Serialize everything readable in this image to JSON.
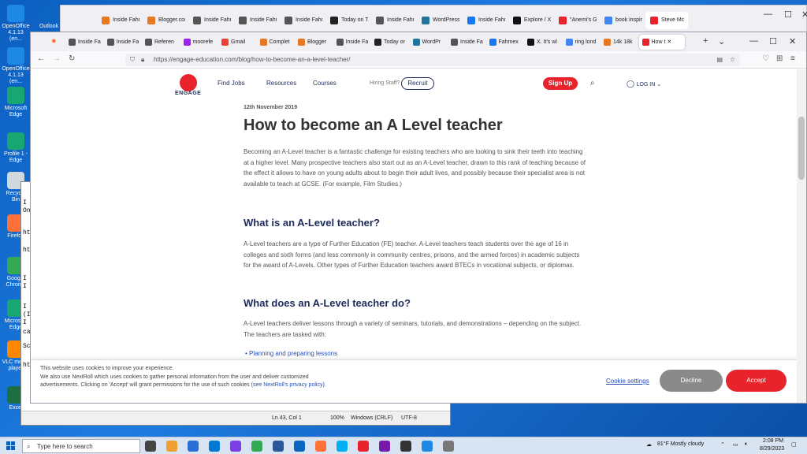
{
  "desktop": {
    "icons": [
      {
        "label": "OpenOffice 4.1.13 (en...",
        "color": "#1e88e5"
      },
      {
        "label": "OpenOffice 4.1.13 (en...",
        "color": "#1e88e5"
      },
      {
        "label": "Microsoft Edge",
        "color": "#18a673"
      },
      {
        "label": "Profile 1 - Edge",
        "color": "#18a673"
      },
      {
        "label": "Recycle Bin",
        "color": "#cfd8dc"
      },
      {
        "label": "Firefox",
        "color": "#ff7139"
      },
      {
        "label": "Google Chrome",
        "color": "#34a853"
      },
      {
        "label": "Microsoft Edge",
        "color": "#18a673"
      },
      {
        "label": "VLC media player",
        "color": "#ff8800"
      },
      {
        "label": "Excel",
        "color": "#1d6f42"
      }
    ],
    "second_icon": {
      "label": "Outlook",
      "color": "#0a64c0"
    }
  },
  "back_window": {
    "tabs": [
      {
        "label": "Inside Fahm",
        "color": "#e87722"
      },
      {
        "label": "Blogger.com",
        "color": "#e87722"
      },
      {
        "label": "Inside Fahm",
        "color": "#555"
      },
      {
        "label": "Inside Fahm",
        "color": "#555"
      },
      {
        "label": "Inside Fahmex",
        "color": "#555"
      },
      {
        "label": "Today on Tu",
        "color": "#222"
      },
      {
        "label": "Inside Fahm",
        "color": "#555"
      },
      {
        "label": "WordPress.c",
        "color": "#21759b"
      },
      {
        "label": "Inside Fahm",
        "color": "#1877f2"
      },
      {
        "label": "Explore / X",
        "color": "#111"
      },
      {
        "label": "\"Anemi's G",
        "color": "#e8232b"
      },
      {
        "label": "book inspir",
        "color": "#4285f4"
      },
      {
        "label": "Steve Mc",
        "color": "#e8232b"
      }
    ]
  },
  "notepad": {
    "lines": [
      "I",
      "On",
      "ht",
      "ht",
      "I",
      "I",
      "I",
      "(I",
      "I",
      "ca",
      "Sc",
      "ht"
    ],
    "status": {
      "pos": "Ln 43, Col 1",
      "zoom": "100%",
      "eol": "Windows (CRLF)",
      "enc": "UTF-8"
    }
  },
  "browser": {
    "tabs": [
      {
        "label": "Inside Fa",
        "color": "#555"
      },
      {
        "label": "Inside Fa",
        "color": "#555"
      },
      {
        "label": "Referen",
        "color": "#555"
      },
      {
        "label": "moorefe",
        "color": "#a020f0"
      },
      {
        "label": "Gmail",
        "color": "#ea4335"
      },
      {
        "label": "Complet",
        "color": "#e87722"
      },
      {
        "label": "Blogger",
        "color": "#e87722"
      },
      {
        "label": "Inside Fa",
        "color": "#555"
      },
      {
        "label": "Today or",
        "color": "#222"
      },
      {
        "label": "WordPr",
        "color": "#21759b"
      },
      {
        "label": "Inside Fa",
        "color": "#555"
      },
      {
        "label": "Fahmex",
        "color": "#1877f2"
      },
      {
        "label": "X. It's wl",
        "color": "#111"
      },
      {
        "label": "ring lond",
        "color": "#4285f4"
      },
      {
        "label": "14k 18k",
        "color": "#e87722"
      },
      {
        "label": "How t",
        "color": "#e8232b"
      }
    ],
    "url": "https://engage-education.com/blog/how-to-become-an-a-level-teacher/"
  },
  "site": {
    "logo_text": "ENGAGE",
    "logo_sub": "EDUCATION",
    "nav": [
      "Find Jobs",
      "Resources",
      "Courses"
    ],
    "hiring": "Hiring Staff?",
    "recruit": "Recruit",
    "signup": "Sign Up",
    "login": "LOG IN ⌄"
  },
  "article": {
    "date": "12th November 2019",
    "title": "How to become an A Level teacher",
    "intro": "Becoming an A-Level teacher is a fantastic challenge for existing teachers who are looking to sink their teeth into teaching at a higher level. Many prospective teachers also start out as an A-Level teacher, drawn to this rank of teaching because of the effect it allows to have on young adults about to begin their adult lives, and possibly because their specialist area is not available to teach at GCSE. (For example, Film Studies.)",
    "h_what": "What is an A-Level teacher?",
    "p_what": "A-Level teachers are a type of Further Education (FE) teacher. A-Level teachers teach students over the age of 16 in colleges and sixth forms (and less commonly in community centres, prisons, and the armed forces) in academic subjects for the award of A-Levels. Other types of Further Education teachers award BTECs in vocational subjects, or diplomas.",
    "h_do": "What does an A-Level teacher do?",
    "p_do": "A-Level teachers deliver lessons through a variety of seminars, tutorials, and demonstrations – depending on the subject. The teachers are tasked with:",
    "bullet": "Planning and preparing lessons"
  },
  "cookie": {
    "l1": "This website uses cookies to improve your experience.",
    "l2": "We also use NextRoll which uses cookies to gather personal information from the user and deliver customized advertisements. Clicking on 'Accept' will grant permissions for the use of such cookies",
    "link": "(see NextRoll's privacy policy).",
    "settings": "Cookie settings",
    "decline": "Decline",
    "accept": "Accept"
  },
  "taskbar": {
    "search_placeholder": "Type here to search",
    "weather": "81°F  Mostly cloudy",
    "time": "2:08 PM",
    "date": "8/29/2023",
    "apps": [
      "#444",
      "#f0a030",
      "#2a6dd4",
      "#0078d4",
      "#7b3fe4",
      "#34a853",
      "#2b579a",
      "#0a64c0",
      "#ff7139",
      "#00aff0",
      "#e8232b",
      "#7719aa",
      "#333",
      "#1e88e5",
      "#777"
    ]
  }
}
